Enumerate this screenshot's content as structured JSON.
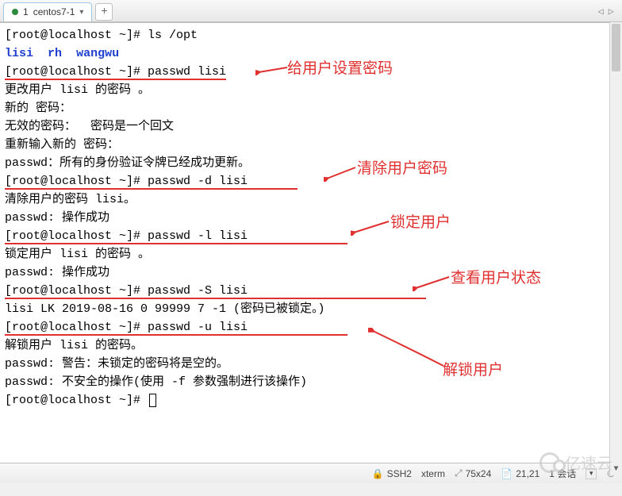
{
  "tab": {
    "index": "1",
    "title": "centos7-1"
  },
  "terminal": {
    "prompt": "[root@localhost ~]# ",
    "cmd_ls": "ls /opt",
    "dirs": {
      "d1": "lisi",
      "d2": "rh",
      "d3": "wangwu"
    },
    "cmd_passwd_set": "passwd lisi",
    "msg_change": "更改用户 lisi 的密码 。",
    "msg_new": "新的 密码：",
    "msg_invalid": "无效的密码：  密码是一个回文",
    "msg_retype": "重新输入新的 密码：",
    "msg_updated": "passwd：所有的身份验证令牌已经成功更新。",
    "cmd_passwd_d": "passwd -d lisi",
    "msg_clear": "清除用户的密码 lisi。",
    "msg_ok": "passwd: 操作成功",
    "cmd_passwd_l": "passwd -l lisi",
    "msg_lock": "锁定用户 lisi 的密码 。",
    "cmd_passwd_S": "passwd -S lisi",
    "msg_status": "lisi LK 2019-08-16 0 99999 7 -1 (密码已被锁定。)",
    "cmd_passwd_u": "passwd -u lisi",
    "msg_unlock": "解锁用户 lisi 的密码。",
    "msg_warn": "passwd: 警告：未锁定的密码将是空的。",
    "msg_unsafe": "passwd: 不安全的操作(使用 -f 参数强制进行该操作)"
  },
  "annotations": {
    "set_pw": "给用户设置密码",
    "clear_pw": "清除用户密码",
    "lock_user": "锁定用户",
    "check_status": "查看用户状态",
    "unlock_user": "解锁用户"
  },
  "status": {
    "proto": "SSH2",
    "term": "xterm",
    "size": "75x24",
    "pos": "21,21",
    "session": "1 会话"
  },
  "watermark": "亿速云"
}
